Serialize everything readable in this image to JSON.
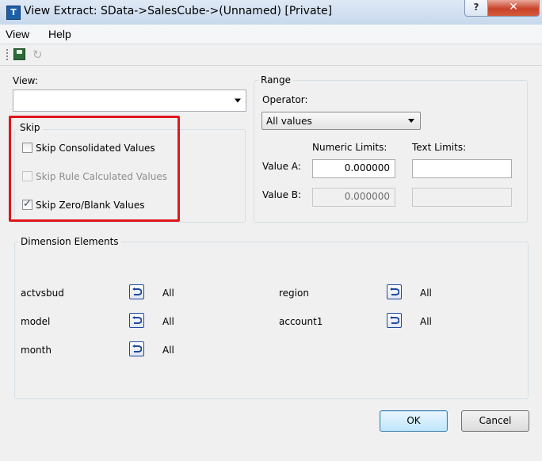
{
  "window": {
    "title": "View Extract:  SData->SalesCube->(Unnamed)  [Private]",
    "app_icon_glyph": "T",
    "help_glyph": "?",
    "close_glyph": "✕"
  },
  "menu": {
    "items": [
      "View",
      "Help"
    ]
  },
  "toolbar": {
    "icons": [
      "save-icon",
      "undo-icon"
    ]
  },
  "view": {
    "label": "View:",
    "value": ""
  },
  "skip": {
    "title": "Skip",
    "options": [
      {
        "label": "Skip Consolidated Values",
        "checked": false,
        "disabled": false
      },
      {
        "label": "Skip Rule Calculated Values",
        "checked": false,
        "disabled": true
      },
      {
        "label": "Skip Zero/Blank Values",
        "checked": true,
        "disabled": false
      }
    ],
    "highlight_color": "#e0151c"
  },
  "range": {
    "title": "Range",
    "operator_label": "Operator:",
    "operator_value": "All values",
    "numeric_limits_label": "Numeric Limits:",
    "text_limits_label": "Text Limits:",
    "value_a_label": "Value A:",
    "value_b_label": "Value B:",
    "value_a_numeric": "0.000000",
    "value_a_text": "",
    "value_b_numeric": "0.000000",
    "value_b_text": ""
  },
  "dimensions": {
    "title": "Dimension Elements",
    "left": [
      {
        "name": "actvsbud",
        "value": "All"
      },
      {
        "name": "model",
        "value": "All"
      },
      {
        "name": "month",
        "value": "All"
      }
    ],
    "right": [
      {
        "name": "region",
        "value": "All"
      },
      {
        "name": "account1",
        "value": "All"
      }
    ]
  },
  "buttons": {
    "ok": "OK",
    "cancel": "Cancel"
  },
  "colors": {
    "close_button": "#c8432a",
    "dimension_icon": "#1f4a9c",
    "ok_border": "#3c7fb1"
  }
}
